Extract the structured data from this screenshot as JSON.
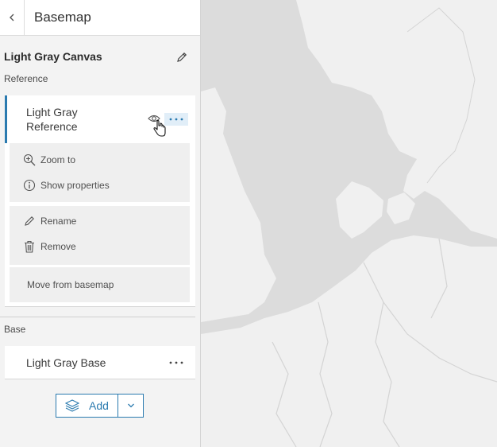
{
  "header": {
    "title": "Basemap"
  },
  "basemap": {
    "title": "Light Gray Canvas"
  },
  "reference": {
    "label": "Reference",
    "layer": {
      "name_line1": "Light Gray",
      "name_line2": "Reference"
    }
  },
  "menu": {
    "zoom_to": "Zoom to",
    "show_properties": "Show properties",
    "rename": "Rename",
    "remove": "Remove",
    "move_from_basemap": "Move from basemap"
  },
  "base": {
    "label": "Base",
    "layer": {
      "name": "Light Gray Base"
    }
  },
  "add_button": {
    "label": "Add"
  },
  "colors": {
    "accent": "#2a7aaf",
    "map_land": "#f0f0f0",
    "map_water": "#dcdcdc"
  }
}
